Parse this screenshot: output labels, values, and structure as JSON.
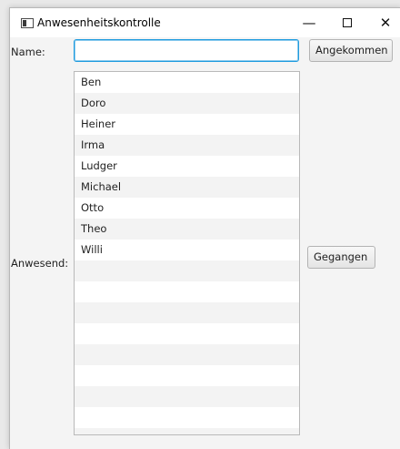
{
  "window": {
    "title": "Anwesenheitskontrolle",
    "minimize_glyph": "—",
    "close_glyph": "✕"
  },
  "form": {
    "name_label": "Name:",
    "name_value": "",
    "arrived_button": "Angekommen",
    "present_label": "Anwesend:",
    "left_button": "Gegangen"
  },
  "list": {
    "items": [
      "Ben",
      "Doro",
      "Heiner",
      "Irma",
      "Ludger",
      "Michael",
      "Otto",
      "Theo",
      "Willi",
      "",
      "",
      "",
      "",
      "",
      "",
      "",
      "",
      ""
    ]
  },
  "colors": {
    "focus_border": "#1f9bde",
    "stripe": "#f3f3f3"
  }
}
